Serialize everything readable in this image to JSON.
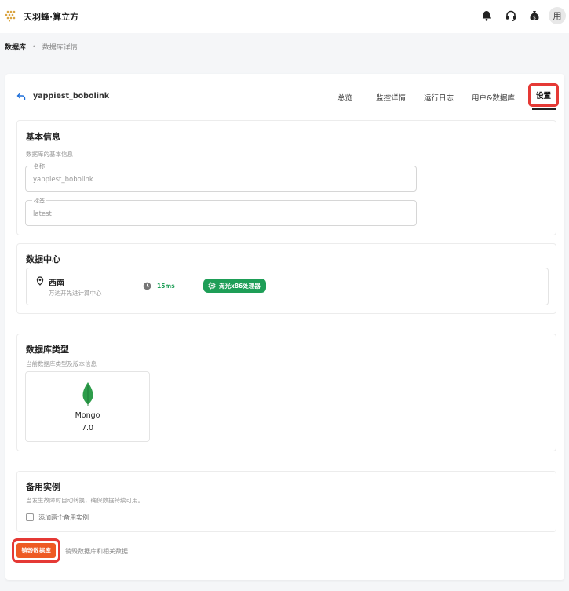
{
  "app": {
    "brand": "天羽蜂·算立方",
    "avatar_text": "用"
  },
  "colors": {
    "accent_red": "#e53935",
    "success_green": "#1e9e57",
    "destroy_orange": "#ee5a24"
  },
  "icons": [
    "logo-icon",
    "bell-icon",
    "headset-icon",
    "money-bag-icon",
    "back-arrow-icon",
    "location-pin-icon",
    "clock-icon",
    "chip-icon",
    "mongodb-leaf-icon"
  ],
  "breadcrumb": {
    "root": "数据库",
    "separator": "•",
    "current": "数据库详情"
  },
  "detail": {
    "db_name": "yappiest_bobolink",
    "tabs": [
      "总览",
      "监控详情",
      "运行日志",
      "用户&数据库",
      "设置"
    ],
    "active_tab": "设置"
  },
  "basic_info": {
    "title": "基本信息",
    "subtitle": "数据库的基本信息",
    "name_label": "名称",
    "name_value": "yappiest_bobolink",
    "tag_label": "标签",
    "tag_value": "latest"
  },
  "data_center": {
    "title": "数据中心",
    "region": "西南",
    "region_desc": "万达开先进计算中心",
    "latency": "15ms",
    "processor": "海光x86处理器"
  },
  "db_type": {
    "title": "数据库类型",
    "subtitle": "当前数据库类型及版本信息",
    "name": "Mongo",
    "version": "7.0"
  },
  "standby": {
    "title": "备用实例",
    "subtitle": "当发生故障时自动转换，确保数据持续可用。",
    "checkbox_label": "添加两个备用实例"
  },
  "destroy": {
    "button_label": "销毁数据库",
    "description": "销毁数据库和相关数据"
  }
}
